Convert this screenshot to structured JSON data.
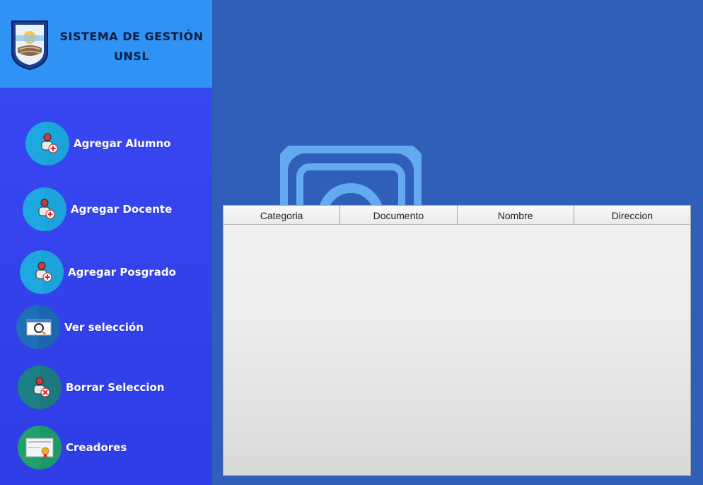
{
  "brand": {
    "title_line1": "SISTEMA DE GESTIÓN",
    "title_line2": "UNSL"
  },
  "nav": {
    "items": [
      {
        "label": "Agregar Alumno",
        "icon": "user-add-icon"
      },
      {
        "label": "Agregar Docente",
        "icon": "user-add-icon"
      },
      {
        "label": "Agregar Posgrado",
        "icon": "user-add-icon"
      },
      {
        "label": "Ver selección",
        "icon": "search-icon"
      },
      {
        "label": "Borrar Seleccion",
        "icon": "user-remove-icon"
      },
      {
        "label": "Creadores",
        "icon": "certificate-icon"
      }
    ]
  },
  "table": {
    "columns": [
      "Categoria",
      "Documento",
      "Nombre",
      "Direccion"
    ],
    "rows": []
  },
  "colors": {
    "sidebar": "#3a49f2",
    "brand_bg": "#2f93f5",
    "main_bg": "#2f5fb8",
    "accent_icon": "#1fa8e0"
  }
}
